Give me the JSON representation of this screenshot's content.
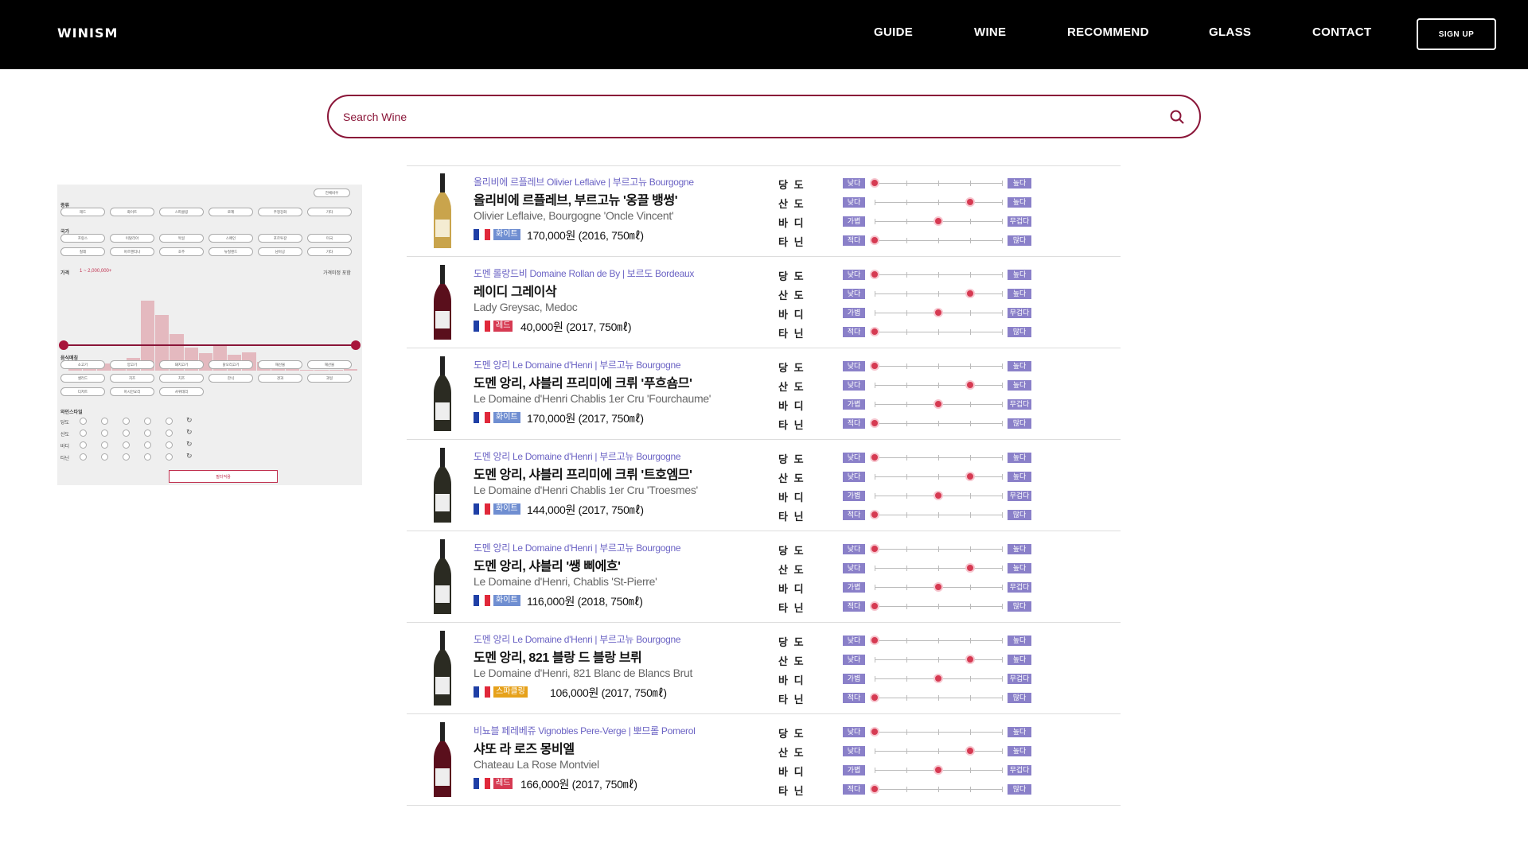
{
  "header": {
    "logo": "WINISM",
    "nav": [
      "GUIDE",
      "WINE",
      "RECOMMEND",
      "GLASS",
      "CONTACT"
    ],
    "signup": "SIGN UP"
  },
  "search": {
    "placeholder": "Search Wine"
  },
  "filter": {
    "top_button": "전체비우",
    "sections": [
      "종류",
      "국가",
      "가격",
      "음식매칭",
      "와인스타일"
    ],
    "type_options": [
      "레드",
      "화이트",
      "스파클링",
      "로제",
      "주정강화",
      "기타"
    ],
    "country_options": [
      "프랑스",
      "이탈리아",
      "독일",
      "스페인",
      "포르투갈",
      "미국",
      "칠레",
      "아르헨티나",
      "호주",
      "뉴질랜드",
      "남아공",
      "기타"
    ],
    "price_range": "1 ~ 2,000,000+",
    "price_check": "가격미정 포함",
    "food_options": [
      "소고기",
      "양고기",
      "돼지고기",
      "닭오리고기",
      "해산물",
      "해산물",
      "샐러드",
      "치즈",
      "치즈",
      "한식",
      "견과",
      "과일",
      "디저트",
      "아시안요리",
      "샤퀴테리"
    ],
    "style_labels": [
      "당도",
      "산도",
      "바디",
      "타닌"
    ],
    "apply": "필터적용",
    "histogram": [
      2,
      5,
      7,
      10,
      13,
      72,
      57,
      38,
      24,
      18,
      27,
      16,
      19,
      9,
      4,
      2,
      1,
      1,
      1,
      2
    ]
  },
  "attrs": [
    "당 도",
    "산 도",
    "바 디",
    "타 닌"
  ],
  "attr_tags": [
    {
      "low": "낮다",
      "high": "높다"
    },
    {
      "low": "낮다",
      "high": "높다"
    },
    {
      "low": "가볍다",
      "high": "무겁다"
    },
    {
      "low": "적다",
      "high": "많다"
    }
  ],
  "type_colors": {
    "화이트": "#6f8ed1",
    "레드": "#d63a52",
    "스파클링": "#e6a11a"
  },
  "wines": [
    {
      "winery": "올리비에 르플레브 Olivier Leflaive | 부르고뉴 Bourgogne",
      "name_ko": "올리비에 르플레브, 부르고뉴 '옹끌 뱅썽'",
      "name_en": "Olivier Leflaive, Bourgogne 'Oncle Vincent'",
      "type": "화이트",
      "price": "170,000원 (2016, 750㎖)",
      "levels": [
        0,
        3,
        2,
        0
      ],
      "bottle": "white"
    },
    {
      "winery": "도멘 롤랑드비 Domaine Rollan de By | 보르도 Bordeaux",
      "name_ko": "레이디 그레이삭",
      "name_en": "Lady Greysac, Medoc",
      "type": "레드",
      "price": "40,000원 (2017, 750㎖)",
      "levels": [
        0,
        3,
        2,
        0
      ],
      "bottle": "red"
    },
    {
      "winery": "도멘 앙리 Le Domaine d'Henri | 부르고뉴 Bourgogne",
      "name_ko": "도멘 앙리, 샤블리 프리미에 크뤼 '푸흐숌므'",
      "name_en": "Le Domaine d'Henri Chablis 1er Cru 'Fourchaume'",
      "type": "화이트",
      "price": "170,000원 (2017, 750㎖)",
      "levels": [
        0,
        3,
        2,
        0
      ],
      "bottle": "dark"
    },
    {
      "winery": "도멘 앙리 Le Domaine d'Henri | 부르고뉴 Bourgogne",
      "name_ko": "도멘 앙리, 샤블리 프리미에 크뤼 '트호엠므'",
      "name_en": "Le Domaine d'Henri Chablis 1er Cru 'Troesmes'",
      "type": "화이트",
      "price": "144,000원 (2017, 750㎖)",
      "levels": [
        0,
        3,
        2,
        0
      ],
      "bottle": "dark"
    },
    {
      "winery": "도멘 앙리 Le Domaine d'Henri | 부르고뉴 Bourgogne",
      "name_ko": "도멘 앙리, 샤블리 '쌩 삐에흐'",
      "name_en": "Le Domaine d'Henri, Chablis 'St-Pierre'",
      "type": "화이트",
      "price": "116,000원 (2018, 750㎖)",
      "levels": [
        0,
        3,
        2,
        0
      ],
      "bottle": "dark"
    },
    {
      "winery": "도멘 앙리 Le Domaine d'Henri | 부르고뉴 Bourgogne",
      "name_ko": "도멘 앙리, 821 블랑 드 블랑 브뤼",
      "name_en": "Le Domaine d'Henri, 821 Blanc de Blancs Brut",
      "type": "스파클링",
      "price": "106,000원 (2017, 750㎖)",
      "levels": [
        0,
        3,
        2,
        0
      ],
      "bottle": "dark"
    },
    {
      "winery": "비뇨블 페레베쥬 Vignobles Pere-Verge | 뽀므롤 Pomerol",
      "name_ko": "샤또 라 로즈 몽비엘",
      "name_en": "Chateau La Rose Montviel",
      "type": "레드",
      "price": "166,000원 (2017, 750㎖)",
      "levels": [
        0,
        3,
        2,
        0
      ],
      "bottle": "red"
    }
  ]
}
